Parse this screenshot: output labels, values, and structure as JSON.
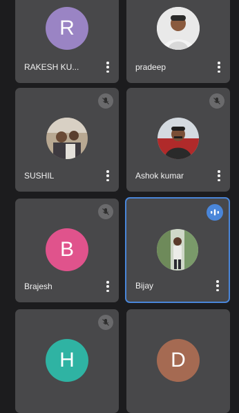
{
  "participants": [
    {
      "name": "RAKESH KU...",
      "initial": "R",
      "avatar_color": "#9a84c4",
      "muted": false
    },
    {
      "name": "pradeep",
      "initial": "",
      "avatar_color": "#e6e6e6",
      "muted": false
    },
    {
      "name": "SUSHIL",
      "initial": "",
      "avatar_color": "#8a7a6a",
      "muted": true
    },
    {
      "name": "Ashok kumar",
      "initial": "",
      "avatar_color": "#c8d0d8",
      "muted": true
    },
    {
      "name": "Brajesh",
      "initial": "B",
      "avatar_color": "#e0538c",
      "muted": true
    },
    {
      "name": "Bijay",
      "initial": "",
      "avatar_color": "#7a9a6a",
      "muted": false,
      "speaking": true
    },
    {
      "name": "",
      "initial": "H",
      "avatar_color": "#2fb3a3",
      "muted": true
    },
    {
      "name": "",
      "initial": "D",
      "avatar_color": "#a56a52",
      "muted": false
    }
  ],
  "colors": {
    "tile": "#48484a",
    "background": "#1c1c1e",
    "active_border": "#4a86d9"
  }
}
